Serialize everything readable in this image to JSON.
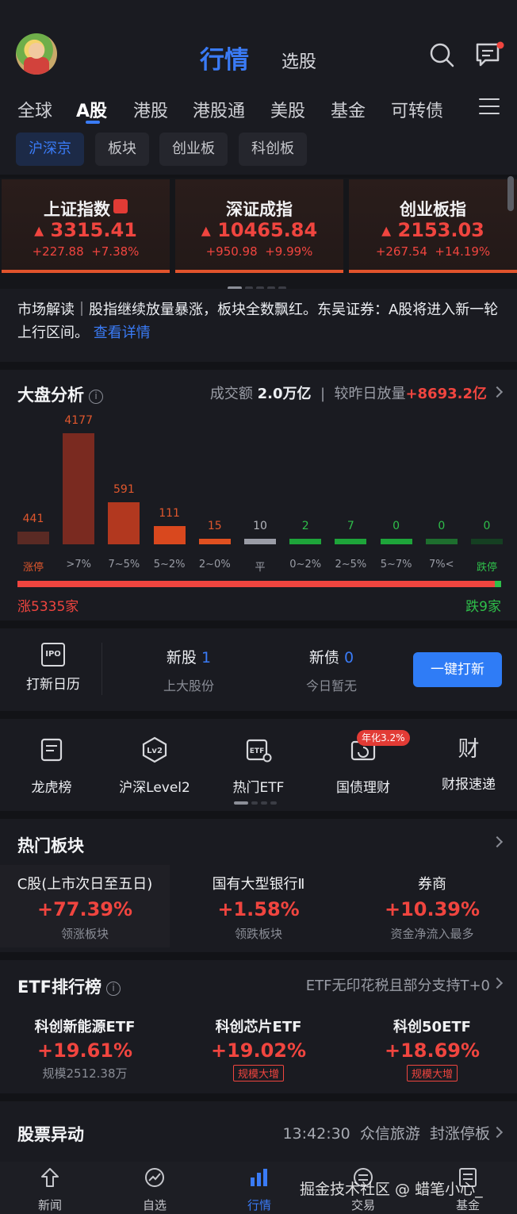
{
  "header": {
    "title": "行情",
    "subtitle": "选股"
  },
  "market_tabs": [
    "全球",
    "A股",
    "港股",
    "港股通",
    "美股",
    "基金",
    "可转债"
  ],
  "sub_tabs": [
    "沪深京",
    "板块",
    "创业板",
    "科创板"
  ],
  "indices": [
    {
      "name": "上证指数",
      "value": "3315.41",
      "change": "+227.88",
      "pct": "+7.38%"
    },
    {
      "name": "深证成指",
      "value": "10465.84",
      "change": "+950.98",
      "pct": "+9.99%"
    },
    {
      "name": "创业板指",
      "value": "2153.03",
      "change": "+267.54",
      "pct": "+14.19%"
    }
  ],
  "news": {
    "text": "市场解读｜股指继续放量暴涨，板块全数飘红。东吴证券：A股将进入新一轮上行区间。",
    "more": "查看详情"
  },
  "analysis": {
    "title": "大盘分析",
    "volume_label": "成交额",
    "volume_value": "2.0万亿",
    "compare_label": "较昨日放量",
    "compare_value": "+8693.2亿",
    "rise_text": "涨5335家",
    "fall_text": "跌9家",
    "rise_fraction": 0.998
  },
  "chart_data": {
    "type": "bar",
    "categories": [
      "涨停",
      ">7%",
      "7~5%",
      "5~2%",
      "2~0%",
      "平",
      "0~2%",
      "2~5%",
      "5~7%",
      "7%<",
      "跌停"
    ],
    "values": [
      441,
      4177,
      591,
      111,
      15,
      10,
      2,
      7,
      0,
      0,
      0
    ],
    "colors": [
      "#5a2a24",
      "#7a2a20",
      "#b2381f",
      "#d9481e",
      "#e05020",
      "#9a9ca6",
      "#1ea43a",
      "#1ea43a",
      "#1ea43a",
      "#1e6e2e",
      "#153f22"
    ],
    "label_colors": [
      "#e0572d",
      "#9a9da6",
      "#9a9da6",
      "#9a9da6",
      "#9a9da6",
      "#9a9da6",
      "#9a9da6",
      "#9a9da6",
      "#9a9da6",
      "#9a9da6",
      "#2fbf4a"
    ],
    "value_colors": [
      "#e0572d",
      "#e0572d",
      "#e0572d",
      "#e0572d",
      "#e0572d",
      "#b4b6bd",
      "#2fbf4a",
      "#2fbf4a",
      "#2fbf4a",
      "#2fbf4a",
      "#2fbf4a"
    ]
  },
  "ipo": {
    "calendar": "打新日历",
    "calendar_icon": "IPO",
    "new_stock": {
      "label": "新股",
      "count": "1",
      "sub": "上大股份"
    },
    "new_bond": {
      "label": "新债",
      "count": "0",
      "sub": "今日暂无"
    },
    "button": "一键打新"
  },
  "entries": [
    {
      "label": "龙虎榜",
      "icon": "list-icon"
    },
    {
      "label": "沪深Level2",
      "icon": "lv2-icon",
      "badge": "Lv2"
    },
    {
      "label": "热门ETF",
      "icon": "etf-icon",
      "badge": "ETF"
    },
    {
      "label": "国债理财",
      "icon": "bond-icon"
    },
    {
      "label": "财报速递",
      "icon": "report-icon",
      "badge": "财"
    }
  ],
  "entry_tag": "年化3.2%",
  "hot": {
    "title": "热门板块",
    "items": [
      {
        "name": "C股(上市次日至五日)",
        "pct": "+77.39%",
        "desc": "领涨板块"
      },
      {
        "name": "国有大型银行Ⅱ",
        "pct": "+1.58%",
        "desc": "领跌板块"
      },
      {
        "name": "券商",
        "pct": "+10.39%",
        "desc": "资金净流入最多"
      }
    ]
  },
  "etf": {
    "title": "ETF排行榜",
    "note": "ETF无印花税且部分支持T+0",
    "items": [
      {
        "name": "科创新能源ETF",
        "pct": "+19.61%",
        "desc": "规模2512.38万"
      },
      {
        "name": "科创芯片ETF",
        "pct": "+19.02%",
        "tag": "规模大增"
      },
      {
        "name": "科创50ETF",
        "pct": "+18.69%",
        "tag": "规模大增"
      }
    ]
  },
  "movement": {
    "title": "股票异动",
    "time": "13:42:30",
    "stock": "众信旅游",
    "event": "封涨停板"
  },
  "nav": [
    "新闻",
    "自选",
    "行情",
    "交易",
    "基金"
  ],
  "watermark": "掘金技术社区 @ 蜡笔小心_"
}
